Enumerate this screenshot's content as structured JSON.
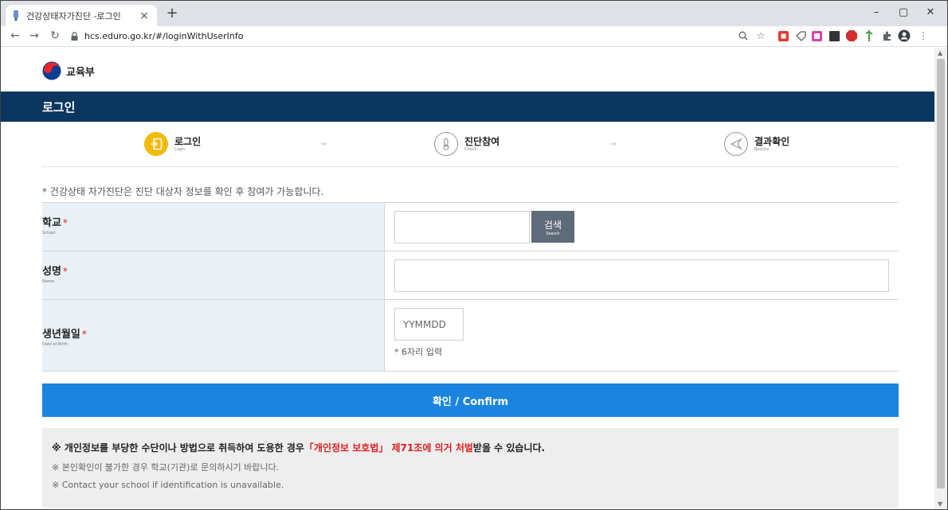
{
  "browser": {
    "tab_title": "건강상태자가진단 -로그인",
    "tab_close": "×",
    "new_tab": "+",
    "minimize": "–",
    "maximize": "▢",
    "close": "✕",
    "url": "hcs.eduro.go.kr/#/loginWithUserInfo"
  },
  "header": {
    "logo_text": "교육부",
    "page_title": "로그인"
  },
  "steps": [
    {
      "label": "로그인",
      "sub": "Login",
      "icon": "login-icon",
      "active": true
    },
    {
      "label": "진단참여",
      "sub": "Check",
      "icon": "thermometer-icon",
      "active": false
    },
    {
      "label": "결과확인",
      "sub": "Results",
      "icon": "send-icon",
      "active": false
    }
  ],
  "step_arrow": "→",
  "notice": "* 건강상태 자가진단은 진단 대상자 정보를 확인 후 참여가 가능합니다.",
  "form": {
    "school": {
      "label": "학교",
      "en": "School",
      "required_mark": "*",
      "value": "",
      "search_label": "검색",
      "search_en": "Search"
    },
    "name": {
      "label": "성명",
      "en": "Name",
      "required_mark": "*",
      "value": ""
    },
    "birth": {
      "label": "생년월일",
      "en": "Date of Birth",
      "required_mark": "*",
      "placeholder": "YYMMDD",
      "hint": "* 6자리 입력"
    }
  },
  "confirm_label": "확인 / Confirm",
  "warnings": {
    "line1_pre": "※ 개인정보를 부당한 수단이나 방법으로 취득하여 도용한 경우",
    "line1_hl": "「개인정보 보호법」 제71조에 의거 처벌",
    "line1_post": "받을 수 있습니다.",
    "line2": "※ 본인확인이 불가한 경우 학교(기관)로 문의하시기 바랍니다.",
    "line3": "※ Contact your school if identification is unavailable."
  },
  "colors": {
    "title_bar": "#0b3660",
    "confirm": "#1a84de",
    "active_step": "#f5b800",
    "required": "#e02020"
  }
}
